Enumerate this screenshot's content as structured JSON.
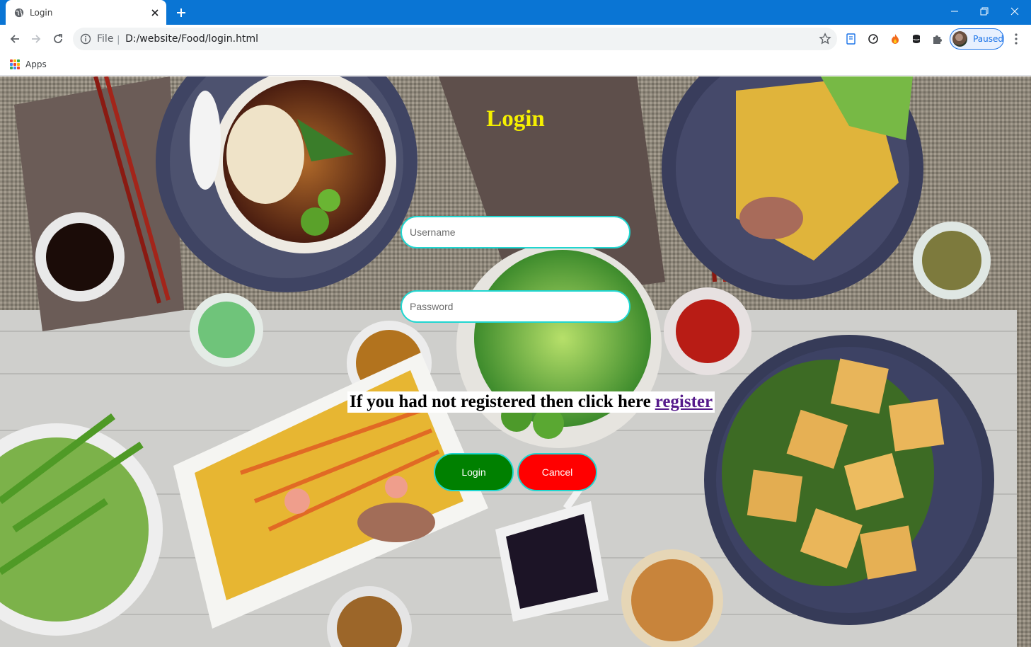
{
  "browser": {
    "tab_title": "Login",
    "url_scheme": "File",
    "url_separator": "|",
    "url": "D:/website/Food/login.html",
    "profile_label": "Paused",
    "bookmarks": [
      {
        "label": "Apps"
      }
    ],
    "icons": [
      "globe-icon",
      "close-icon",
      "plus-icon",
      "minimize-icon",
      "restore-icon",
      "window-close-icon",
      "back-icon",
      "forward-icon",
      "reload-icon",
      "info-icon",
      "star-icon",
      "reading-list-icon",
      "speed-icon",
      "fire-icon",
      "database-icon",
      "puzzle-icon",
      "menu-icon"
    ]
  },
  "page": {
    "title": "Login",
    "username_placeholder": "Username",
    "password_placeholder": "Password",
    "register_prompt": "If you had not registered then click here",
    "register_link": "register",
    "login_button": "Login",
    "cancel_button": "Cancel"
  },
  "colors": {
    "title": "#f5f000",
    "login_button": "#008000",
    "cancel_button": "#ff0000",
    "input_border": "#20d6d0",
    "link": "#551a8b",
    "titlebar": "#0a75d4"
  }
}
